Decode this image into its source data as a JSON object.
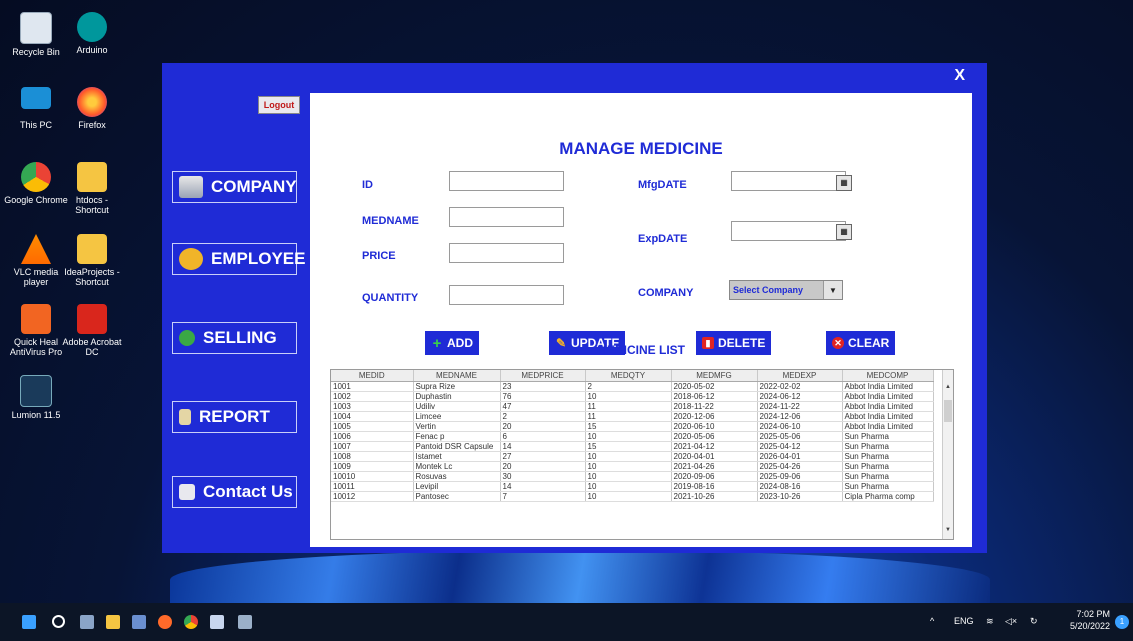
{
  "desktop": {
    "icons": [
      {
        "label": "Recycle Bin",
        "icon": "recycle-bin-icon"
      },
      {
        "label": "Arduino",
        "icon": "arduino-icon"
      },
      {
        "label": "This PC",
        "icon": "monitor-icon"
      },
      {
        "label": "Firefox",
        "icon": "firefox-icon"
      },
      {
        "label": "Google Chrome",
        "icon": "chrome-icon"
      },
      {
        "label": "htdocs - Shortcut",
        "icon": "folder-icon"
      },
      {
        "label": "VLC media player",
        "icon": "vlc-icon"
      },
      {
        "label": "IdeaProjects - Shortcut",
        "icon": "folder-icon"
      },
      {
        "label": "Quick Heal AntiVirus Pro",
        "icon": "quickheal-icon"
      },
      {
        "label": "Adobe Acrobat DC",
        "icon": "acrobat-icon"
      },
      {
        "label": "Lumion 11.5",
        "icon": "lumion-icon"
      }
    ]
  },
  "app": {
    "close_label": "X",
    "logout_label": "Logout",
    "nav": [
      {
        "label": "COMPANY",
        "icon": "database-icon"
      },
      {
        "label": "EMPLOYEE",
        "icon": "people-icon"
      },
      {
        "label": "SELLING",
        "icon": "money-icon"
      },
      {
        "label": "REPORT",
        "icon": "report-icon"
      },
      {
        "label": "Contact Us",
        "icon": "contact-icon"
      }
    ],
    "title": "MANAGE MEDICINE",
    "form": {
      "id_label": "ID",
      "medname_label": "MEDNAME",
      "price_label": "PRICE",
      "quantity_label": "QUANTITY",
      "mfg_label": "MfgDATE",
      "exp_label": "ExpDATE",
      "company_label": "COMPANY",
      "company_select": "Select Company",
      "id_value": "",
      "medname_value": "",
      "price_value": "",
      "quantity_value": ""
    },
    "buttons": {
      "add": "ADD",
      "update": "UPDATE",
      "delete": "DELETE",
      "clear": "CLEAR"
    },
    "list_title": "MEDICINE LIST",
    "table": {
      "headers": [
        "MEDID",
        "MEDNAME",
        "MEDPRICE",
        "MEDQTY",
        "MEDMFG",
        "MEDEXP",
        "MEDCOMP"
      ],
      "rows": [
        [
          "1001",
          "Supra Rize",
          "23",
          "2",
          "2020-05-02",
          "2022-02-02",
          "Abbot India Limited"
        ],
        [
          "1002",
          "Duphastin",
          "76",
          "10",
          "2018-06-12",
          "2024-06-12",
          "Abbot India Limited"
        ],
        [
          "1003",
          "Udiliv",
          "47",
          "11",
          "2018-11-22",
          "2024-11-22",
          "Abbot India Limited"
        ],
        [
          "1004",
          "Limcee",
          "2",
          "11",
          "2020-12-06",
          "2024-12-06",
          "Abbot India Limited"
        ],
        [
          "1005",
          "Vertin",
          "20",
          "15",
          "2020-06-10",
          "2024-06-10",
          "Abbot India Limited"
        ],
        [
          "1006",
          "Fenac p",
          "6",
          "10",
          "2020-05-06",
          "2025-05-06",
          "Sun Pharma"
        ],
        [
          "1007",
          "Pantoid DSR Capsule",
          "14",
          "15",
          "2021-04-12",
          "2025-04-12",
          "Sun Pharma"
        ],
        [
          "1008",
          "Istamet",
          "27",
          "10",
          "2020-04-01",
          "2026-04-01",
          "Sun Pharma"
        ],
        [
          "1009",
          "Montek Lc",
          "20",
          "10",
          "2021-04-26",
          "2025-04-26",
          "Sun Pharma"
        ],
        [
          "10010",
          "Rosuvas",
          "30",
          "10",
          "2020-09-06",
          "2025-09-06",
          "Sun Pharma"
        ],
        [
          "10011",
          "Levipil",
          "14",
          "10",
          "2019-08-16",
          "2024-08-16",
          "Sun Pharma"
        ],
        [
          "10012",
          "Pantosec",
          "7",
          "10",
          "2021-10-26",
          "2023-10-26",
          "Cipla Pharma comp"
        ]
      ]
    }
  },
  "taskbar": {
    "lang": "ENG",
    "time": "7:02 PM",
    "date": "5/20/2022",
    "notifications": "1"
  },
  "colors": {
    "app_blue": "#1f2bd6",
    "logout_red": "#c01919"
  }
}
